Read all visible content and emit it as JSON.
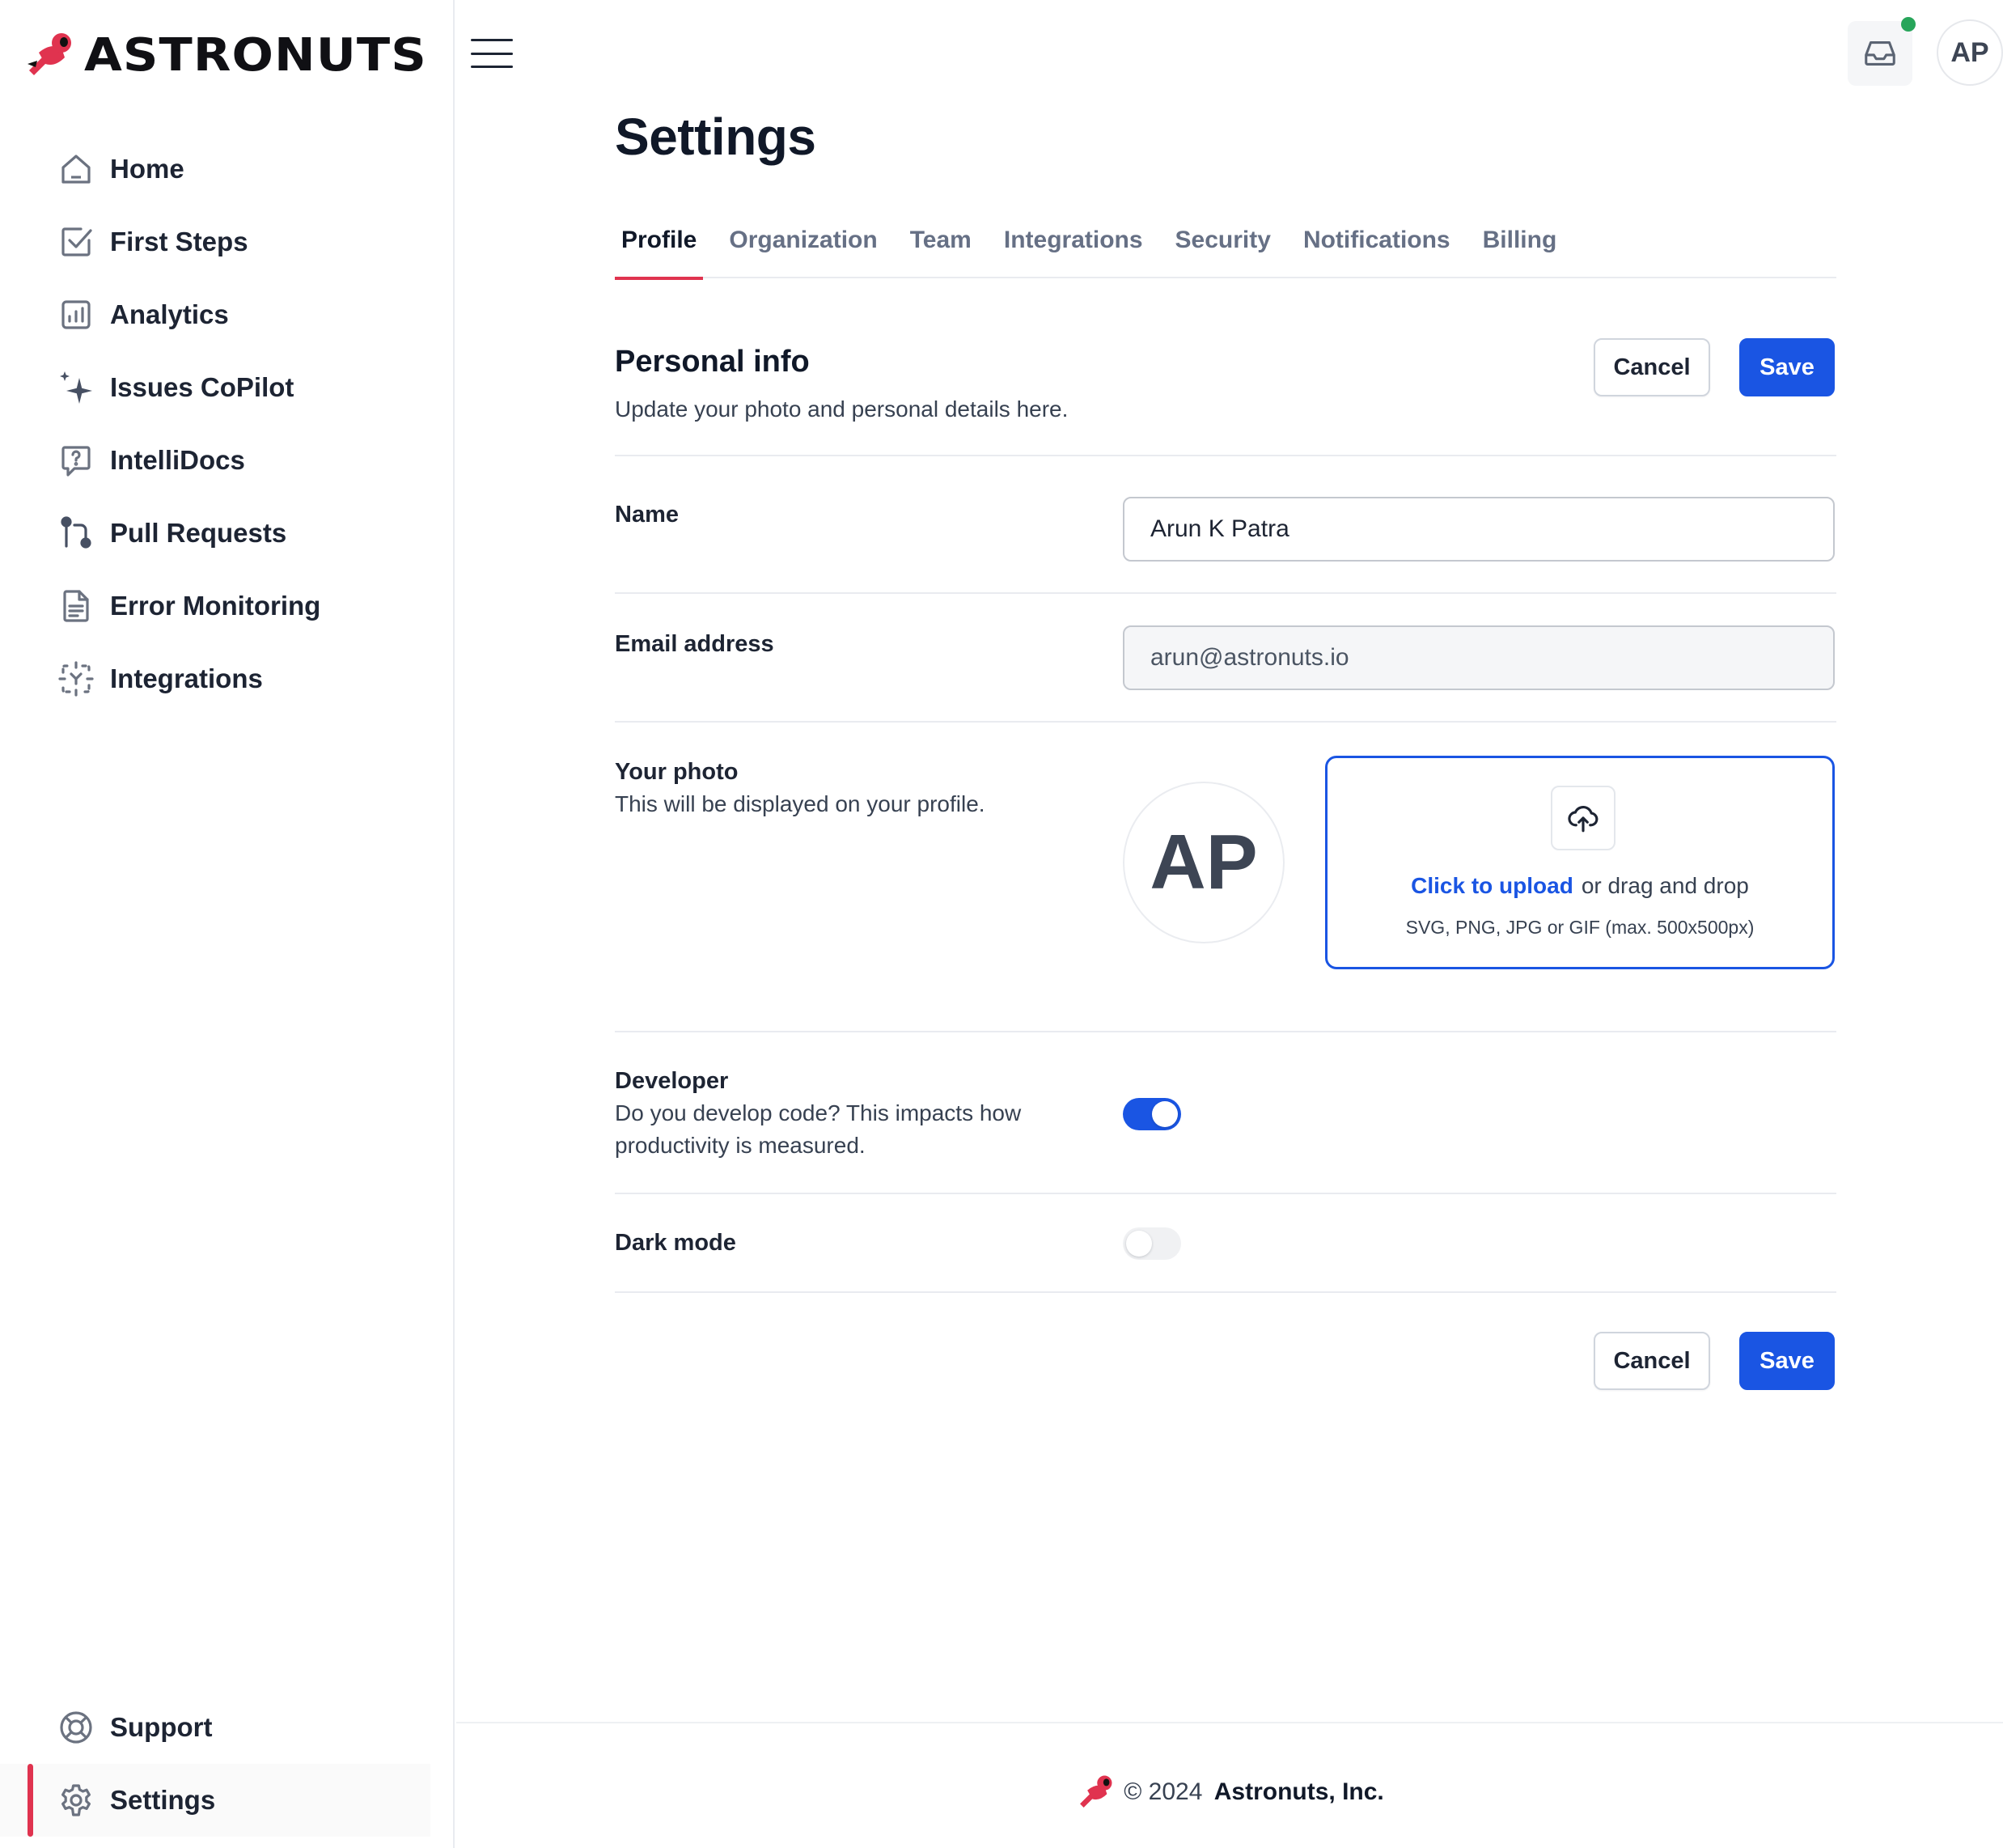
{
  "brand": {
    "name": "ASTRONUTS",
    "accent_color": "#e0334f"
  },
  "sidebar": {
    "items": [
      {
        "label": "Home",
        "icon": "home-icon"
      },
      {
        "label": "First Steps",
        "icon": "checkbox-icon"
      },
      {
        "label": "Analytics",
        "icon": "bar-chart-icon"
      },
      {
        "label": "Issues CoPilot",
        "icon": "sparkles-icon"
      },
      {
        "label": "IntelliDocs",
        "icon": "help-message-icon"
      },
      {
        "label": "Pull Requests",
        "icon": "git-pull-request-icon"
      },
      {
        "label": "Error Monitoring",
        "icon": "file-document-icon"
      },
      {
        "label": "Integrations",
        "icon": "integrations-icon"
      }
    ],
    "bottom_items": [
      {
        "label": "Support",
        "icon": "life-buoy-icon"
      },
      {
        "label": "Settings",
        "icon": "gear-icon",
        "active": true
      }
    ]
  },
  "topbar": {
    "avatar_initials": "AP",
    "notification_color": "#27a55a"
  },
  "page": {
    "title": "Settings"
  },
  "tabs": [
    {
      "label": "Profile",
      "active": true
    },
    {
      "label": "Organization"
    },
    {
      "label": "Team"
    },
    {
      "label": "Integrations"
    },
    {
      "label": "Security"
    },
    {
      "label": "Notifications"
    },
    {
      "label": "Billing"
    }
  ],
  "personal_info": {
    "title": "Personal info",
    "subtitle": "Update your photo and personal details here.",
    "cancel_label": "Cancel",
    "save_label": "Save"
  },
  "form": {
    "name": {
      "label": "Name",
      "value": "Arun K Patra"
    },
    "email": {
      "label": "Email address",
      "value": "arun@astronuts.io"
    },
    "photo": {
      "label": "Your photo",
      "description": "This will be displayed on your profile.",
      "avatar_initials": "AP",
      "upload_link": "Click to upload",
      "upload_text": "or drag and drop",
      "upload_hint": "SVG, PNG, JPG or GIF (max. 500x500px)"
    },
    "developer": {
      "label": "Developer",
      "description": "Do you develop code? This impacts how productivity is measured.",
      "enabled": true
    },
    "dark_mode": {
      "label": "Dark mode",
      "enabled": false
    }
  },
  "footer_actions": {
    "cancel_label": "Cancel",
    "save_label": "Save"
  },
  "footer": {
    "copyright": "© 2024",
    "company": "Astronuts, Inc."
  },
  "colors": {
    "primary": "#1a55e3",
    "accent": "#e0334f"
  }
}
